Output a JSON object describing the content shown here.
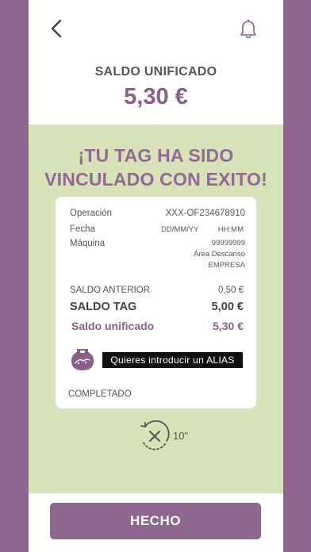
{
  "header": {
    "back_icon": "chevron-left-icon",
    "bell_icon": "bell-icon",
    "saldo_label": "SALDO UNIFICADO",
    "saldo_value": "5,30 €"
  },
  "success": {
    "line1": "¡TU TAG HA SIDO",
    "line2": "VINCULADO CON EXITO!"
  },
  "receipt": {
    "operacion_label": "Operación",
    "operacion_value": "XXX-OF234678910",
    "fecha_label": "Fecha",
    "fecha_date": "DD/MM/YY",
    "fecha_time": "HH:MM",
    "maquina_label": "Máquina",
    "maquina_id": "99999999",
    "maquina_area": "Área Descanso",
    "maquina_company": "EMPRESA",
    "saldo_anterior_label": "SALDO ANTERIOR",
    "saldo_anterior_value": "0,50 €",
    "saldo_tag_label": "SALDO TAG",
    "saldo_tag_value": "5,00 €",
    "saldo_unificado_label": "Saldo unificado",
    "saldo_unificado_value": "5,30 €",
    "alias_button": "Quieres introducir un ALIAS",
    "status": "COMPLETADO",
    "logo_icon": "tag-logo-icon"
  },
  "timer": {
    "icon": "timer-cancel-icon",
    "text": "10\""
  },
  "footer": {
    "hecho_label": "HECHO"
  },
  "colors": {
    "brand_purple": "#8f668f",
    "panel_green": "#d8e2b9"
  }
}
